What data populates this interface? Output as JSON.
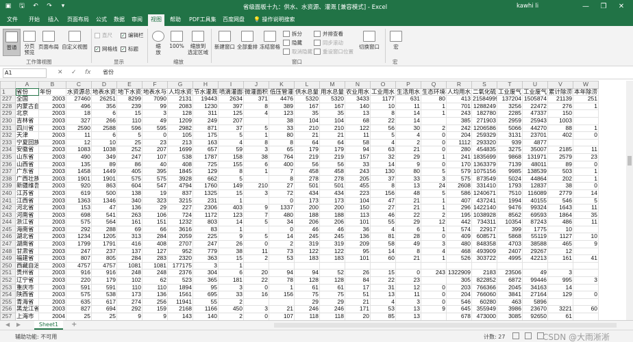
{
  "titlebar": {
    "title": "省级面板十九：供水、水资源、灌溉 [兼容模式] - Excel",
    "user": "kawhi li",
    "minimize": "—",
    "restore": "❐",
    "close": "✕"
  },
  "tabs": [
    "文件",
    "开始",
    "插入",
    "页面布局",
    "公式",
    "数据",
    "审阅",
    "视图",
    "帮助",
    "PDF工具集",
    "百度网盘"
  ],
  "active_tab": "视图",
  "tell_me": "操作说明搜索",
  "ribbon": {
    "group_workbook_views": {
      "label": "工作簿视图",
      "normal": "普通",
      "page_break": "分页\n预览",
      "page_layout": "页面布局",
      "custom_views": "自定义视图"
    },
    "group_show": {
      "label": "显示",
      "ruler": "直尺",
      "gridlines": "网格线",
      "formula_bar": "编辑栏",
      "headings": "标题"
    },
    "group_zoom": {
      "label": "缩放",
      "zoom": "缩\n放",
      "zoom100": "100%",
      "zoom_sel": "缩放到\n选定区域"
    },
    "group_window": {
      "label": "窗口",
      "new_window": "新建窗口",
      "arrange_all": "全部重排",
      "freeze": "冻结窗格",
      "split": "拆分",
      "hide": "隐藏",
      "unhide": "取消隐藏",
      "side_by_side": "并排查看",
      "sync_scroll": "同步滚动",
      "reset_pos": "重设窗口位置",
      "switch": "切换窗口"
    },
    "group_macros": {
      "label": "宏",
      "macros": "宏"
    }
  },
  "formula": {
    "namebox": "A1",
    "cancel": "✕",
    "enter": "✓",
    "fx": "fx",
    "content": "省份"
  },
  "grid": {
    "columns": [
      "A",
      "B",
      "C",
      "D",
      "E",
      "F",
      "G",
      "H",
      "I",
      "J",
      "K",
      "L",
      "M",
      "N",
      "O",
      "P",
      "Q",
      "R",
      "S",
      "T",
      "U",
      "V",
      "W"
    ],
    "header_row": {
      "row": "1",
      "cells": [
        "省份",
        "年份",
        "水资源总量",
        "地表水资源",
        "地下水资源",
        "地表水与地下",
        "人均水资源",
        "节水灌溉面积",
        "喷滴灌面积",
        "微灌面积",
        "低压管灌面积",
        "供水总量",
        "用水总量",
        "农业用水",
        "工业用水",
        "生活用水",
        "生态环境补水",
        "人均用水量",
        "二氧化硫",
        "工业废气",
        "工业废气排放",
        "累计除涝面积",
        "本年除涝"
      ]
    },
    "rows": [
      {
        "row": "227",
        "cells": [
          "全国",
          "2003",
          "27460",
          "26251",
          "8299",
          "7090",
          "2131",
          "19443",
          "2634",
          "371",
          "4476",
          "5320",
          "5320",
          "3433",
          "1177",
          "631",
          "80",
          "413",
          "21584999",
          "137204",
          "1505874",
          "21139",
          "251"
        ]
      },
      {
        "row": "228",
        "cells": [
          "内蒙古自治",
          "2003",
          "496",
          "356",
          "239",
          "99",
          "2083",
          "1230",
          "397",
          "8",
          "389",
          "167",
          "167",
          "140",
          "10",
          "11",
          "1",
          "701",
          "1288249",
          "3256",
          "22472",
          "276",
          "1"
        ]
      },
      {
        "row": "229",
        "cells": [
          "北京",
          "2003",
          "18",
          "6",
          "15",
          "3",
          "128",
          "311",
          "125",
          "4",
          "123",
          "35",
          "35",
          "13",
          "8",
          "14",
          "1",
          "243",
          "182780",
          "2285",
          "47337",
          "150",
          ""
        ]
      },
      {
        "row": "230",
        "cells": [
          "吉林省",
          "2003",
          "327",
          "266",
          "110",
          "49",
          "1209",
          "249",
          "207",
          "",
          "38",
          "104",
          "104",
          "68",
          "22",
          "14",
          "",
          "385",
          "271903",
          "2959",
          "25943",
          "1003",
          ""
        ]
      },
      {
        "row": "231",
        "cells": [
          "四川省",
          "2003",
          "2590",
          "2588",
          "596",
          "595",
          "2982",
          "871",
          "37",
          "5",
          "33",
          "210",
          "210",
          "122",
          "56",
          "30",
          "2",
          "242",
          "1206586",
          "5066",
          "44270",
          "88",
          "1"
        ]
      },
      {
        "row": "232",
        "cells": [
          "天津",
          "2003",
          "11",
          "6",
          "5",
          "0",
          "105",
          "175",
          "5",
          "1",
          "80",
          "21",
          "21",
          "11",
          "5",
          "4",
          "0",
          "204",
          "259329",
          "3131",
          "23701",
          "402",
          "0"
        ]
      },
      {
        "row": "233",
        "cells": [
          "宁夏回族自",
          "2003",
          "12",
          "10",
          "25",
          "23",
          "213",
          "163",
          "4",
          "8",
          "8",
          "64",
          "64",
          "58",
          "4",
          "2",
          "0",
          "1112",
          "293320",
          "939",
          "4877",
          "",
          ""
        ]
      },
      {
        "row": "234",
        "cells": [
          "安徽省",
          "2003",
          "1083",
          "1038",
          "252",
          "207",
          "1699",
          "657",
          "59",
          "3",
          "65",
          "179",
          "179",
          "94",
          "63",
          "21",
          "0",
          "280",
          "454835",
          "3275",
          "35007",
          "2185",
          "11"
        ]
      },
      {
        "row": "235",
        "cells": [
          "山东省",
          "2003",
          "490",
          "349",
          "247",
          "107",
          "538",
          "1787",
          "158",
          "38",
          "764",
          "219",
          "219",
          "157",
          "32",
          "29",
          "1",
          "241",
          "1835699",
          "9868",
          "131971",
          "2579",
          "23"
        ]
      },
      {
        "row": "236",
        "cells": [
          "山西省",
          "2003",
          "135",
          "89",
          "86",
          "40",
          "408",
          "725",
          "155",
          "6",
          "400",
          "56",
          "56",
          "33",
          "14",
          "9",
          "0",
          "170",
          "1363379",
          "7139",
          "48011",
          "89",
          "0"
        ]
      },
      {
        "row": "237",
        "cells": [
          "广东省",
          "2003",
          "1458",
          "1449",
          "405",
          "395",
          "1845",
          "129",
          "8",
          "1",
          "7",
          "458",
          "458",
          "243",
          "130",
          "80",
          "5",
          "579",
          "1075156",
          "9985",
          "138539",
          "503",
          "1"
        ]
      },
      {
        "row": "238",
        "cells": [
          "广西壮族自",
          "2003",
          "1901",
          "1901",
          "575",
          "575",
          "3928",
          "662",
          "5",
          "",
          "8",
          "278",
          "278",
          "205",
          "37",
          "33",
          "3",
          "575",
          "873549",
          "5024",
          "44864",
          "202",
          "1"
        ]
      },
      {
        "row": "239",
        "cells": [
          "新疆维吾尔",
          "2003",
          "920",
          "863",
          "604",
          "547",
          "4794",
          "1760",
          "149",
          "210",
          "27",
          "501",
          "501",
          "455",
          "8",
          "13",
          "24",
          "2608",
          "331410",
          "1793",
          "12837",
          "38",
          "0"
        ]
      },
      {
        "row": "240",
        "cells": [
          "江苏省",
          "2003",
          "619",
          "500",
          "138",
          "19",
          "837",
          "1325",
          "15",
          "3",
          "72",
          "434",
          "434",
          "223",
          "156",
          "48",
          "5",
          "586",
          "1240671",
          "7510",
          "116089",
          "2779",
          "14"
        ]
      },
      {
        "row": "241",
        "cells": [
          "江西省",
          "2003",
          "1363",
          "1346",
          "340",
          "323",
          "3215",
          "231",
          "1",
          "",
          "0",
          "173",
          "173",
          "104",
          "47",
          "21",
          "1",
          "407",
          "437241",
          "1994",
          "40155",
          "546",
          "5"
        ]
      },
      {
        "row": "242",
        "cells": [
          "河北省",
          "2003",
          "153",
          "47",
          "136",
          "29",
          "227",
          "2306",
          "403",
          "9",
          "1337",
          "200",
          "200",
          "150",
          "27",
          "21",
          "1",
          "296",
          "1422140",
          "9476",
          "99324",
          "1643",
          "11"
        ]
      },
      {
        "row": "243",
        "cells": [
          "河南省",
          "2003",
          "698",
          "541",
          "263",
          "106",
          "724",
          "1172",
          "123",
          "7",
          "480",
          "188",
          "188",
          "113",
          "46",
          "22",
          "2",
          "195",
          "1038928",
          "8562",
          "69593",
          "1864",
          "35"
        ]
      },
      {
        "row": "244",
        "cells": [
          "浙江省",
          "2003",
          "575",
          "564",
          "161",
          "151",
          "1232",
          "803",
          "14",
          "5",
          "34",
          "206",
          "206",
          "101",
          "55",
          "29",
          "12",
          "442",
          "734311",
          "10354",
          "87243",
          "486",
          "11"
        ]
      },
      {
        "row": "245",
        "cells": [
          "海南省",
          "2003",
          "292",
          "288",
          "69",
          "66",
          "3616",
          "83",
          "1",
          "",
          "0",
          "46",
          "46",
          "36",
          "4",
          "6",
          "1",
          "574",
          "22917",
          "399",
          "1775",
          "10",
          ""
        ]
      },
      {
        "row": "246",
        "cells": [
          "湖北省",
          "2003",
          "1234",
          "1205",
          "313",
          "284",
          "2059",
          "225",
          "9",
          "5",
          "14",
          "245",
          "245",
          "136",
          "81",
          "28",
          "0",
          "409",
          "608571",
          "5868",
          "55119",
          "1127",
          "10"
        ]
      },
      {
        "row": "247",
        "cells": [
          "湖南省",
          "2003",
          "1799",
          "1791",
          "416",
          "408",
          "2707",
          "247",
          "26",
          "0",
          "2",
          "319",
          "319",
          "209",
          "58",
          "49",
          "3",
          "480",
          "848358",
          "4703",
          "38588",
          "465",
          "9"
        ]
      },
      {
        "row": "248",
        "cells": [
          "甘肃省",
          "2003",
          "247",
          "237",
          "137",
          "127",
          "952",
          "779",
          "38",
          "11",
          "73",
          "122",
          "122",
          "95",
          "14",
          "8",
          "4",
          "468",
          "493909",
          "2407",
          "29267",
          "12",
          ""
        ]
      },
      {
        "row": "249",
        "cells": [
          "福建省",
          "2003",
          "807",
          "805",
          "284",
          "283",
          "2320",
          "363",
          "15",
          "2",
          "53",
          "183",
          "183",
          "101",
          "60",
          "21",
          "1",
          "526",
          "303722",
          "4995",
          "42213",
          "161",
          "41"
        ]
      },
      {
        "row": "250",
        "cells": [
          "西藏自治区",
          "2003",
          "4757",
          "4757",
          "1081",
          "1081",
          "177175",
          "3",
          "1",
          "",
          "",
          "",
          "",
          "",
          "",
          "",
          "",
          "",
          "",
          "",
          "",
          "",
          ""
        ]
      },
      {
        "row": "251",
        "cells": [
          "贵州省",
          "2003",
          "916",
          "916",
          "248",
          "248",
          "2376",
          "304",
          "6",
          "20",
          "94",
          "94",
          "52",
          "26",
          "15",
          "0",
          "243",
          "1322909",
          "2183",
          "23506",
          "49",
          "3",
          ""
        ]
      },
      {
        "row": "252",
        "cells": [
          "辽宁省",
          "2003",
          "220",
          "179",
          "102",
          "62",
          "523",
          "365",
          "181",
          "22",
          "78",
          "128",
          "128",
          "84",
          "22",
          "23",
          "",
          "305",
          "822852",
          "6872",
          "99446",
          "995",
          "3"
        ]
      },
      {
        "row": "253",
        "cells": [
          "重庆市",
          "2003",
          "591",
          "591",
          "110",
          "110",
          "1894",
          "95",
          "3",
          "0",
          "1",
          "61",
          "61",
          "17",
          "31",
          "12",
          "0",
          "203",
          "766366",
          "2045",
          "34163",
          "14",
          ""
        ]
      },
      {
        "row": "254",
        "cells": [
          "陕西省",
          "2003",
          "575",
          "538",
          "173",
          "136",
          "1561",
          "695",
          "33",
          "16",
          "156",
          "75",
          "75",
          "51",
          "13",
          "11",
          "0",
          "204",
          "766060",
          "3841",
          "27164",
          "129",
          "0"
        ]
      },
      {
        "row": "255",
        "cells": [
          "青海省",
          "2003",
          "635",
          "617",
          "274",
          "256",
          "11941",
          "55",
          "2",
          "",
          "",
          "29",
          "29",
          "21",
          "4",
          "3",
          "0",
          "546",
          "60280",
          "463",
          "5896",
          "",
          ""
        ]
      },
      {
        "row": "256",
        "cells": [
          "黑龙江省",
          "2003",
          "827",
          "694",
          "292",
          "159",
          "2168",
          "1166",
          "450",
          "3",
          "21",
          "246",
          "246",
          "171",
          "53",
          "13",
          "9",
          "645",
          "355949",
          "3986",
          "23670",
          "3221",
          "60"
        ]
      },
      {
        "row": "257",
        "cells": [
          "上海市",
          "2004",
          "25",
          "25",
          "9",
          "9",
          "143",
          "140",
          "2",
          "0",
          "107",
          "118",
          "118",
          "20",
          "85",
          "13",
          "",
          "678",
          "473000",
          "3085",
          "92650",
          "61",
          ""
        ]
      }
    ]
  },
  "sheet": {
    "name": "Sheet1",
    "add": "+",
    "nav_prev": "◀",
    "nav_next": "▶"
  },
  "status": {
    "accessibility": "辅助功能: 不可用",
    "count": "计数: 27",
    "watermark": "CSDN @大雨淅淅"
  }
}
